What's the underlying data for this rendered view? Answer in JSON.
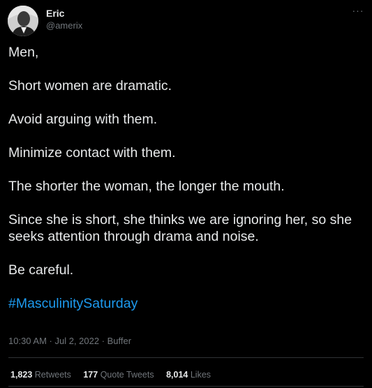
{
  "author": {
    "display_name": "Eric",
    "handle": "@amerix"
  },
  "tweet": {
    "paragraphs": [
      "Men,",
      "Short women are dramatic.",
      "Avoid arguing with them.",
      "Minimize contact with them.",
      "The shorter the woman, the longer the mouth.",
      "Since she is short, she thinks we are ignoring her, so she seeks attention through drama and noise.",
      "Be careful."
    ],
    "hashtag": "#MasculinitySaturday",
    "timestamp": "10:30 AM · Jul 2, 2022 · Buffer"
  },
  "stats": {
    "retweets_count": "1,823",
    "retweets_label": "Retweets",
    "quote_count": "177",
    "quote_label": "Quote Tweets",
    "likes_count": "8,014",
    "likes_label": "Likes"
  },
  "icons": {
    "more": "more-horizontal-icon"
  },
  "colors": {
    "background": "#000000",
    "text": "#e7e9ea",
    "secondary": "#71767b",
    "link": "#1d9bf0",
    "divider": "#2f3336"
  }
}
